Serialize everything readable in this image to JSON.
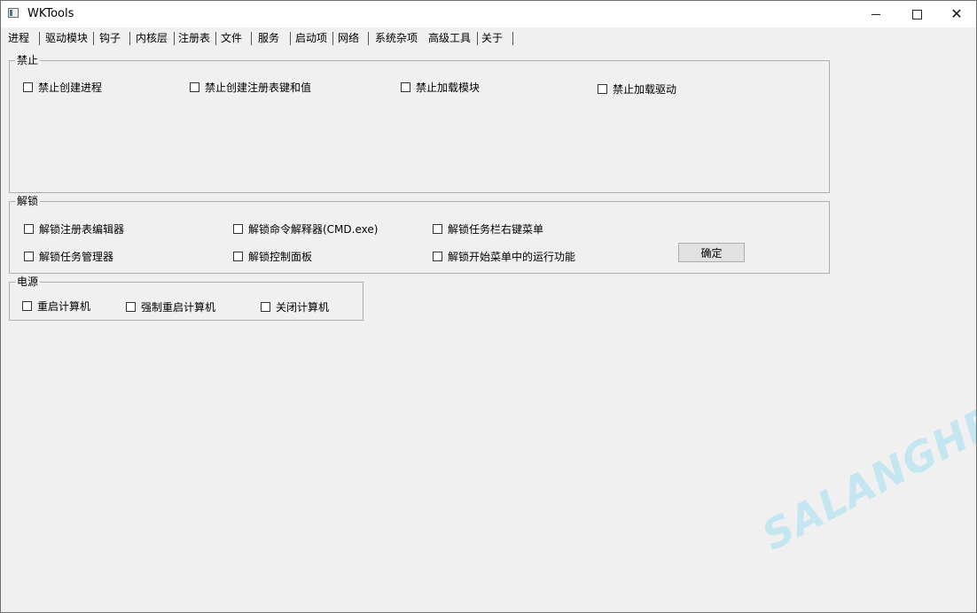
{
  "window": {
    "title": "WKTools",
    "controls": {
      "minimize": "minimize",
      "maximize": "maximize",
      "close": "✕"
    }
  },
  "tabs": [
    {
      "label": "进程"
    },
    {
      "label": "驱动模块"
    },
    {
      "label": "钩子"
    },
    {
      "label": "内核层"
    },
    {
      "label": "注册表"
    },
    {
      "label": "文件"
    },
    {
      "label": "服务"
    },
    {
      "label": "启动项"
    },
    {
      "label": "网络"
    },
    {
      "label": "系统杂项"
    },
    {
      "label": "高级工具",
      "active": true
    },
    {
      "label": "关于"
    }
  ],
  "groups": {
    "forbid": {
      "title": "禁止",
      "items": [
        {
          "label": "禁止创建进程",
          "checked": false
        },
        {
          "label": "禁止创建注册表键和值",
          "checked": false
        },
        {
          "label": "禁止加载模块",
          "checked": false
        },
        {
          "label": "禁止加载驱动",
          "checked": false
        }
      ]
    },
    "unlock": {
      "title": "解锁",
      "items": [
        {
          "label": "解锁注册表编辑器",
          "checked": false
        },
        {
          "label": "解锁命令解释器(CMD.exe)",
          "checked": false
        },
        {
          "label": "解锁任务栏右键菜单",
          "checked": false
        },
        {
          "label": "解锁任务管理器",
          "checked": false
        },
        {
          "label": "解锁控制面板",
          "checked": false
        },
        {
          "label": "解锁开始菜单中的运行功能",
          "checked": false
        }
      ],
      "confirm_label": "确定"
    },
    "power": {
      "title": "电源",
      "items": [
        {
          "label": "重启计算机",
          "checked": false
        },
        {
          "label": "强制重启计算机",
          "checked": false
        },
        {
          "label": "关闭计算机",
          "checked": false
        }
      ]
    }
  },
  "watermark": "SALANGHE",
  "colors": {
    "window_bg": "#f0f0f0",
    "titlebar_bg": "#ffffff",
    "group_border": "#adadad",
    "button_bg": "#e1e1e1",
    "watermark": "#bfe6f2"
  }
}
